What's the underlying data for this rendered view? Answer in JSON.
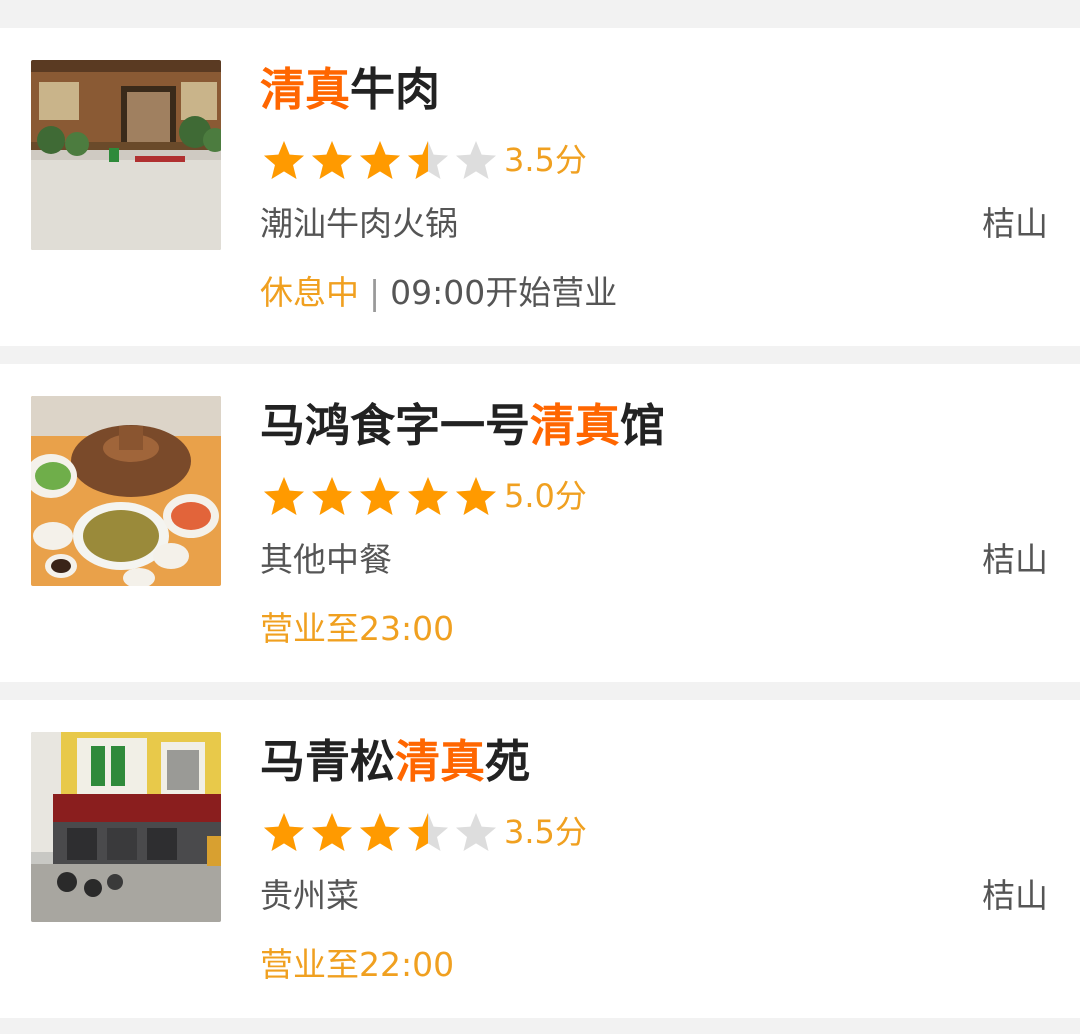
{
  "colors": {
    "highlight": "#ff6600",
    "star_filled": "#ff9a00",
    "star_empty": "#dddddd",
    "score": "#f0a020",
    "status": "#f0a020",
    "title": "#222222",
    "secondary": "#555555"
  },
  "restaurants": [
    {
      "title_parts": [
        {
          "text": "清真",
          "highlight": true
        },
        {
          "text": "牛肉",
          "highlight": false
        }
      ],
      "rating": 3.5,
      "score_label": "3.5分",
      "category": "潮汕牛肉火锅",
      "district": "桔山",
      "status": "休息中",
      "separator": "|",
      "hours": "09:00开始营业",
      "thumb_icon": "storefront-photo"
    },
    {
      "title_parts": [
        {
          "text": "马鸿食字一号",
          "highlight": false
        },
        {
          "text": "清真",
          "highlight": true
        },
        {
          "text": "馆",
          "highlight": false
        }
      ],
      "rating": 5.0,
      "score_label": "5.0分",
      "category": "其他中餐",
      "district": "桔山",
      "status": "",
      "separator": "",
      "hours": "营业至23:00",
      "thumb_icon": "hotpot-dish-photo"
    },
    {
      "title_parts": [
        {
          "text": "马青松",
          "highlight": false
        },
        {
          "text": "清真",
          "highlight": true
        },
        {
          "text": "苑",
          "highlight": false
        }
      ],
      "rating": 3.5,
      "score_label": "3.5分",
      "category": "贵州菜",
      "district": "桔山",
      "status": "",
      "separator": "",
      "hours": "营业至22:00",
      "thumb_icon": "building-facade-photo"
    }
  ]
}
